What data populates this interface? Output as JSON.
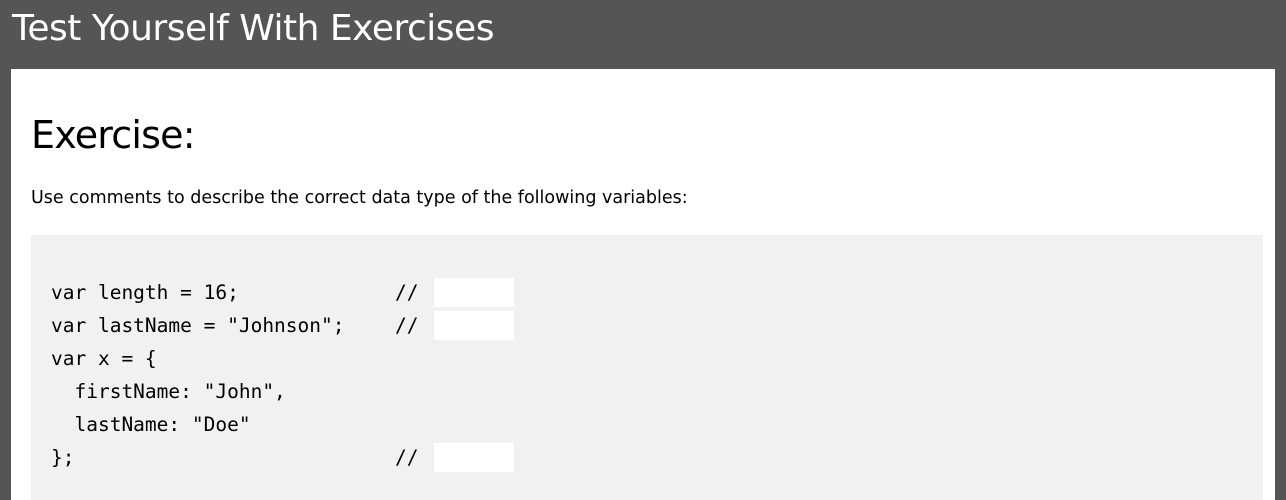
{
  "header": {
    "title": "Test Yourself With Exercises"
  },
  "exercise": {
    "title": "Exercise:",
    "instruction": "Use comments to describe the correct data type of the following variables:",
    "code_lines": [
      "var length = 16;",
      "var lastName = \"Johnson\";",
      "var x = {",
      "  firstName: \"John\",",
      "  lastName: \"Doe\"",
      "};"
    ],
    "comment_marker": "//",
    "answers": [
      {
        "value": "",
        "placeholder": ""
      },
      {
        "value": "",
        "placeholder": ""
      },
      {
        "value": "",
        "placeholder": ""
      }
    ]
  },
  "colors": {
    "header_background": "#555555",
    "header_text": "#ffffff",
    "panel_background": "#ffffff",
    "code_background": "#f1f1f1",
    "input_background": "#ffffff"
  }
}
